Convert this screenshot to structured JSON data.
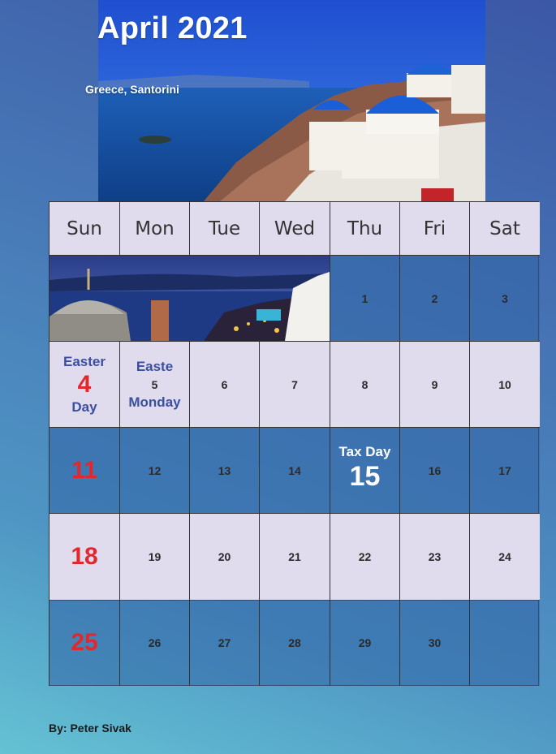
{
  "header": {
    "title": "April 2021",
    "location": "Greece, Santorini"
  },
  "weekdays": [
    "Sun",
    "Mon",
    "Tue",
    "Wed",
    "Thu",
    "Fri",
    "Sat"
  ],
  "weeks": [
    [
      "",
      "",
      "",
      "",
      "1",
      "2",
      "3"
    ],
    [
      "4",
      "5",
      "6",
      "7",
      "8",
      "9",
      "10"
    ],
    [
      "11",
      "12",
      "13",
      "14",
      "15",
      "16",
      "17"
    ],
    [
      "18",
      "19",
      "20",
      "21",
      "22",
      "23",
      "24"
    ],
    [
      "25",
      "26",
      "27",
      "28",
      "29",
      "30",
      ""
    ]
  ],
  "holidays": {
    "easter_top": "Easter",
    "easter_bottom": "Day",
    "easter_monday_top": "Easte",
    "easter_monday_bottom": "Monday",
    "tax_day": "Tax Day"
  },
  "footer": {
    "byline": "By:  Peter Sivak"
  },
  "colors": {
    "sunday_red": "#e0282d",
    "holiday_blue": "#3a4fa0",
    "light_cell": "#e0dcee"
  }
}
